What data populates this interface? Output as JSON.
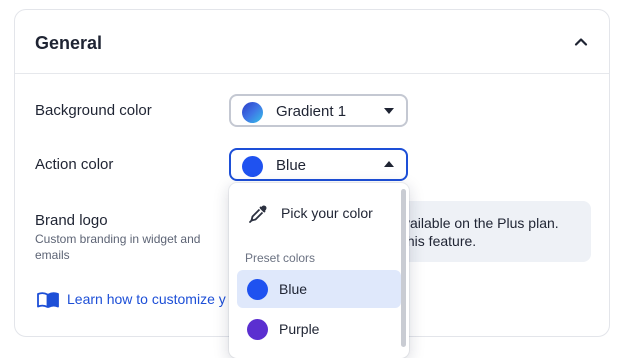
{
  "section": {
    "title": "General"
  },
  "background_color": {
    "label": "Background color",
    "value": "Gradient 1"
  },
  "action_color": {
    "label": "Action color",
    "value": "Blue",
    "swatch": "#1f52f0"
  },
  "brand_logo": {
    "label": "Brand logo",
    "description": "Custom branding in widget and emails",
    "notice_line1": "vailable on the Plus plan.",
    "notice_line2": "this feature."
  },
  "learn_link": {
    "text": "Learn how to customize y"
  },
  "dropdown": {
    "pick_label": "Pick your color",
    "preset_heading": "Preset colors",
    "options": [
      {
        "label": "Blue",
        "color": "#1f52f0",
        "selected": true
      },
      {
        "label": "Purple",
        "color": "#5b2fd0",
        "selected": false
      }
    ]
  },
  "colors": {
    "accent": "#1d4fd7",
    "border": "#c4c8d2",
    "selected_bg": "#dfe8fb"
  }
}
